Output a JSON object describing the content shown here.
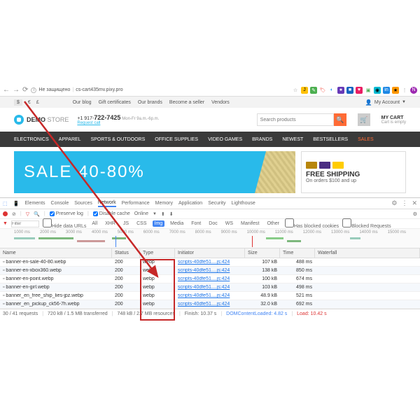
{
  "browser": {
    "security": "Не защищено",
    "url": "cs-cart435mv.pixy.pro"
  },
  "topstrip": {
    "currencies": [
      "$",
      "€",
      "£"
    ],
    "links": [
      "Our blog",
      "Gift certificates",
      "Our brands",
      "Become a seller",
      "Vendors"
    ],
    "account": "My Account"
  },
  "header": {
    "logo1": "DEMO",
    "logo2": "STORE",
    "phone_prefix": "+1 917-",
    "phone_bold": "722-7425",
    "phone_hours": "Mon-Fr 9a.m.-6p.m.",
    "request_call": "Request call",
    "search_placeholder": "Search products",
    "cart_title": "MY CART",
    "cart_sub": "Cart is empty"
  },
  "nav": [
    "ELECTRONICS",
    "APPAREL",
    "SPORTS & OUTDOORS",
    "OFFICE SUPPLIES",
    "VIDEO GAMES",
    "BRANDS",
    "NEWEST",
    "BESTSELLERS",
    "SALES"
  ],
  "sale_banner": {
    "l1": "SALE",
    "l2": "40-80%"
  },
  "ship_banner": {
    "t1": "FREE SHIPPING",
    "t2": "On orders $100 and up"
  },
  "devtools": {
    "tabs": [
      "Elements",
      "Console",
      "Sources",
      "Network",
      "Performance",
      "Memory",
      "Application",
      "Security",
      "Lighthouse"
    ],
    "active_tab": 3,
    "preserve_log": "Preserve log",
    "disable_cache": "Disable cache",
    "online": "Online",
    "filter_placeholder": "Filter",
    "hide_data": "Hide data URLs",
    "types": [
      "All",
      "XHR",
      "JS",
      "CSS",
      "Img",
      "Media",
      "Font",
      "Doc",
      "WS",
      "Manifest",
      "Other"
    ],
    "has_blocked": "Has blocked cookies",
    "blocked_req": "Blocked Requests",
    "timeline_ticks": [
      "1000 ms",
      "2000 ms",
      "3000 ms",
      "4000 ms",
      "5000 ms",
      "6000 ms",
      "7000 ms",
      "8000 ms",
      "9000 ms",
      "10000 ms",
      "11000 ms",
      "12000 ms",
      "13000 ms",
      "14000 ms",
      "15000 ms"
    ],
    "columns": [
      "Name",
      "Status",
      "Type",
      "Initiator",
      "Size",
      "Time",
      "Waterfall"
    ],
    "rows": [
      {
        "name": "banner-en-sale-40-80.webp",
        "status": "200",
        "type": "webp",
        "init": "scripts-40dfe51....js:424",
        "size": "107 kB",
        "time": "488 ms",
        "wf": [
          70,
          4
        ]
      },
      {
        "name": "banner-en-xbox360.webp",
        "status": "200",
        "type": "webp",
        "init": "scripts-40dfe51....js:424",
        "size": "138 kB",
        "time": "850 ms",
        "wf": [
          70,
          7
        ]
      },
      {
        "name": "banner-en-point.webp",
        "status": "200",
        "type": "webp",
        "init": "scripts-40dfe51....js:424",
        "size": "100 kB",
        "time": "674 ms",
        "wf": [
          70,
          6
        ]
      },
      {
        "name": "banner-en-girl.webp",
        "status": "200",
        "type": "webp",
        "init": "scripts-40dfe51....js:424",
        "size": "103 kB",
        "time": "498 ms",
        "wf": [
          70,
          4
        ]
      },
      {
        "name": "banner_en_free_ship_lies-jpz.webp",
        "status": "200",
        "type": "webp",
        "init": "scripts-40dfe51....js:424",
        "size": "48.9 kB",
        "time": "521 ms",
        "wf": [
          70,
          4
        ]
      },
      {
        "name": "banner_en_pickup_ck56-7h.webp",
        "status": "200",
        "type": "webp",
        "init": "scripts-40dfe51....js:424",
        "size": "32.0 kB",
        "time": "692 ms",
        "wf": [
          70,
          6
        ]
      }
    ],
    "status": {
      "requests": "30 / 41 requests",
      "transferred": "720 kB / 1.5 MB transferred",
      "resources": "748 kB / 2.7 MB resources",
      "finish": "Finish: 10.37 s",
      "dcl": "DOMContentLoaded: 4.82 s",
      "load": "Load: 10.42 s"
    }
  }
}
